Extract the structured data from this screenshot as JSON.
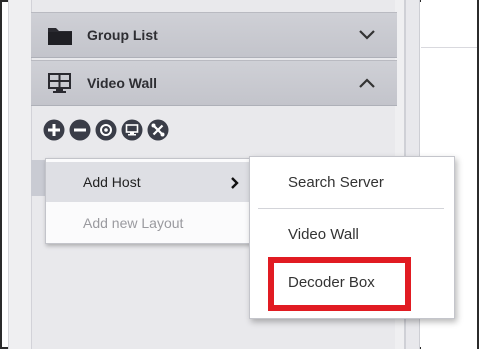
{
  "sidebar": {
    "sections": [
      {
        "title": "Group List",
        "icon": "folder-icon",
        "state": "collapsed"
      },
      {
        "title": "Video Wall",
        "icon": "video-wall-icon",
        "state": "expanded"
      }
    ],
    "toolbar": {
      "icons": [
        "add-icon",
        "remove-icon",
        "settings-icon",
        "monitor-icon",
        "tools-icon"
      ]
    }
  },
  "context_menu": {
    "items": [
      {
        "label": "Add Host",
        "enabled": true,
        "has_submenu": true
      },
      {
        "label": "Add new Layout",
        "enabled": false
      }
    ]
  },
  "submenu": {
    "items": [
      {
        "label": "Search Server"
      },
      {
        "label": "Video Wall"
      },
      {
        "label": "Decoder Box",
        "highlighted": true
      }
    ]
  },
  "colors": {
    "highlight_border": "#e11b22",
    "header_bg": "#c8c9cf",
    "toolbar_icon": "#3a3d48"
  }
}
